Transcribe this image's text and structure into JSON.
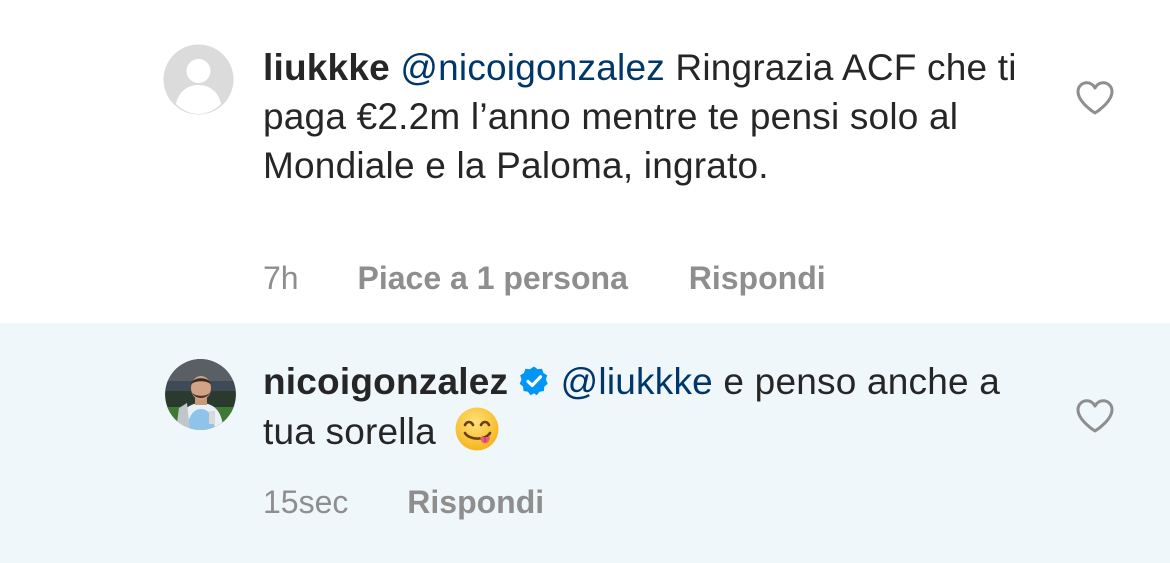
{
  "comments": [
    {
      "username": "liukkke",
      "mention": "@nicoigonzalez",
      "text": " Ringrazia ACF che ti paga €2.2m l’anno mentre te pensi solo al Mondiale e la Paloma, ingrato.",
      "time": "7h",
      "likes": "Piace a 1 persona",
      "reply_label": "Rispondi",
      "avatar": "default-avatar",
      "like_icon": "heart-outline-icon"
    },
    {
      "username": "nicoigonzalez",
      "verified": true,
      "mention": "@liukkke",
      "text": " e penso anche a tua sorella ",
      "emoji": "face-savoring-food",
      "time": "15sec",
      "reply_label": "Rispondi",
      "avatar": "player-photo-avatar",
      "like_icon": "heart-outline-icon"
    }
  ],
  "colors": {
    "text": "#262626",
    "mention": "#00376b",
    "meta": "#8e8e8e",
    "highlight_background": "#eff7fa",
    "verified_badge": "#0095f6"
  }
}
